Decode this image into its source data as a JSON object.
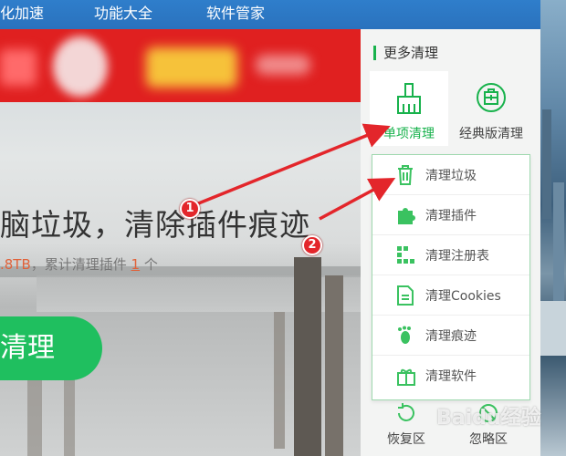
{
  "topnav": {
    "items": [
      "化加速",
      "功能大全",
      "软件管家"
    ]
  },
  "main": {
    "headline": "脑垃圾，清除插件痕迹",
    "stats_prefix": ".8TB",
    "stats_mid": "，累计清理插件 ",
    "stats_count": "1",
    "stats_suffix": " 个",
    "clean_button": "清理"
  },
  "panel": {
    "title": "更多清理",
    "cards": [
      {
        "label": "单项清理",
        "icon": "broom-icon"
      },
      {
        "label": "经典版清理",
        "icon": "classic-clean-icon"
      }
    ],
    "dropdown": [
      {
        "label": "清理垃圾",
        "icon": "trash-icon"
      },
      {
        "label": "清理插件",
        "icon": "puzzle-icon"
      },
      {
        "label": "清理注册表",
        "icon": "registry-icon"
      },
      {
        "label": "清理Cookies",
        "icon": "document-icon"
      },
      {
        "label": "清理痕迹",
        "icon": "footprint-icon"
      },
      {
        "label": "清理软件",
        "icon": "gift-icon"
      }
    ],
    "bottom": [
      {
        "label": "恢复区",
        "icon": "restore-icon"
      },
      {
        "label": "忽略区",
        "icon": "ignore-icon"
      }
    ]
  },
  "annotations": [
    "1",
    "2"
  ],
  "watermark": "Baidu经验",
  "colors": {
    "accent": "#18b24c",
    "nav": "#2f7ecb",
    "banner": "#e02020",
    "arrow": "#e3262b"
  }
}
